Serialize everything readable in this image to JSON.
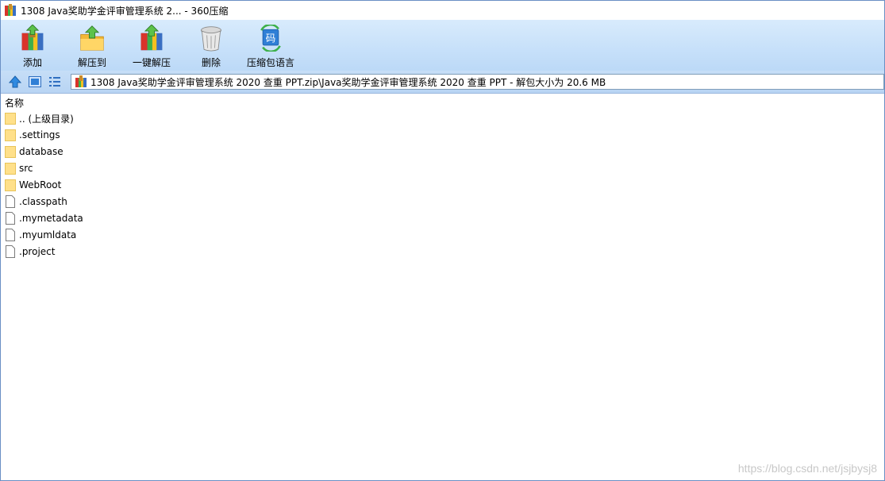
{
  "window": {
    "title": "1308 Java奖助学金评审管理系统 2... - 360压缩"
  },
  "toolbar": {
    "buttons": [
      {
        "label": "添加",
        "icon": "add-archive-icon"
      },
      {
        "label": "解压到",
        "icon": "extract-to-icon"
      },
      {
        "label": "一键解压",
        "icon": "one-click-extract-icon"
      },
      {
        "label": "删除",
        "icon": "delete-icon"
      },
      {
        "label": "压缩包语言",
        "icon": "archive-language-icon"
      }
    ],
    "language_icon_glyph": "码"
  },
  "address": {
    "path": "1308 Java奖助学金评审管理系统 2020 查重 PPT.zip\\Java奖助学金评审管理系统 2020 查重 PPT - 解包大小为 20.6 MB"
  },
  "list": {
    "column_name": "名称",
    "items": [
      {
        "name": ".. (上级目录)",
        "type": "folder"
      },
      {
        "name": ".settings",
        "type": "folder"
      },
      {
        "name": "database",
        "type": "folder"
      },
      {
        "name": "src",
        "type": "folder"
      },
      {
        "name": "WebRoot",
        "type": "folder"
      },
      {
        "name": ".classpath",
        "type": "file"
      },
      {
        "name": ".mymetadata",
        "type": "file"
      },
      {
        "name": ".myumldata",
        "type": "file"
      },
      {
        "name": ".project",
        "type": "file"
      }
    ]
  },
  "watermark": "https://blog.csdn.net/jsjbysj8",
  "colors": {
    "toolbar_bg": "#c8e1fa",
    "folder": "#ffd966",
    "accent": "#2f7fd6"
  }
}
